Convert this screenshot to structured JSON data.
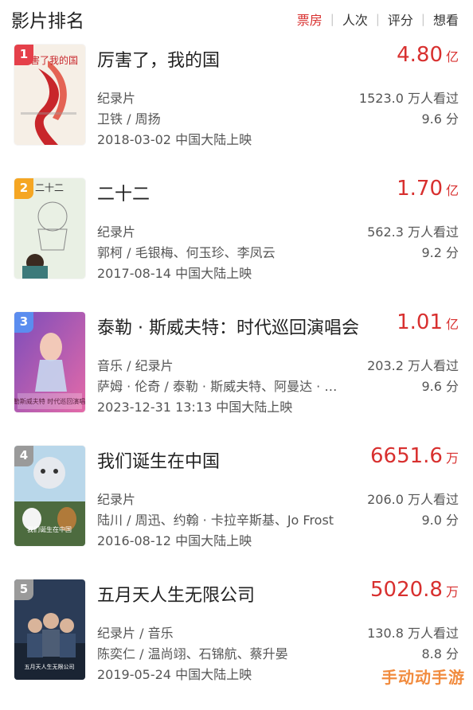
{
  "header": {
    "title": "影片排名",
    "sort_tabs": [
      {
        "label": "票房",
        "active": true
      },
      {
        "label": "人次",
        "active": false
      },
      {
        "label": "评分",
        "active": false
      },
      {
        "label": "想看",
        "active": false
      }
    ]
  },
  "movies": [
    {
      "rank": "1",
      "rank_color": "#e5404a",
      "title": "厉害了，我的国",
      "box_value": "4.80",
      "box_unit": "亿",
      "genre": "纪录片",
      "viewers": "1523.0 万人看过",
      "cast": "卫铁 / 周扬",
      "score": "9.6 分",
      "release": "2018-03-02 中国大陆上映",
      "poster_text": "厉害了我的国"
    },
    {
      "rank": "2",
      "rank_color": "#f5a623",
      "title": "二十二",
      "box_value": "1.70",
      "box_unit": "亿",
      "genre": "纪录片",
      "viewers": "562.3 万人看过",
      "cast": "郭柯 / 毛银梅、何玉珍、李凤云",
      "score": "9.2 分",
      "release": "2017-08-14 中国大陆上映",
      "poster_text": "二十二"
    },
    {
      "rank": "3",
      "rank_color": "#5b8def",
      "title": "泰勒 · 斯威夫特：时代巡回演唱会",
      "box_value": "1.01",
      "box_unit": "亿",
      "genre": "音乐 / 纪录片",
      "viewers": "203.2 万人看过",
      "cast": "萨姆 · 伦奇 / 泰勒 · 斯威夫特、阿曼达 · …",
      "score": "9.6 分",
      "release": "2023-12-31 13:13 中国大陆上映",
      "poster_text": "泰勒斯威夫特 时代巡回演唱会"
    },
    {
      "rank": "4",
      "rank_color": "#9a9a9a",
      "title": "我们诞生在中国",
      "box_value": "6651.6",
      "box_unit": "万",
      "genre": "纪录片",
      "viewers": "206.0 万人看过",
      "cast": "陆川 / 周迅、约翰 · 卡拉辛斯基、Jo Frost",
      "score": "9.0 分",
      "release": "2016-08-12 中国大陆上映",
      "poster_text": "我们诞生在中国"
    },
    {
      "rank": "5",
      "rank_color": "#9a9a9a",
      "title": "五月天人生无限公司",
      "box_value": "5020.8",
      "box_unit": "万",
      "genre": "纪录片 / 音乐",
      "viewers": "130.8 万人看过",
      "cast": "陈奕仁 / 温尚翊、石锦航、蔡升晏",
      "score": "8.8 分",
      "release": "2019-05-24 中国大陆上映",
      "poster_text": "五月天人生无限公司"
    }
  ],
  "watermark": "手动动手游"
}
